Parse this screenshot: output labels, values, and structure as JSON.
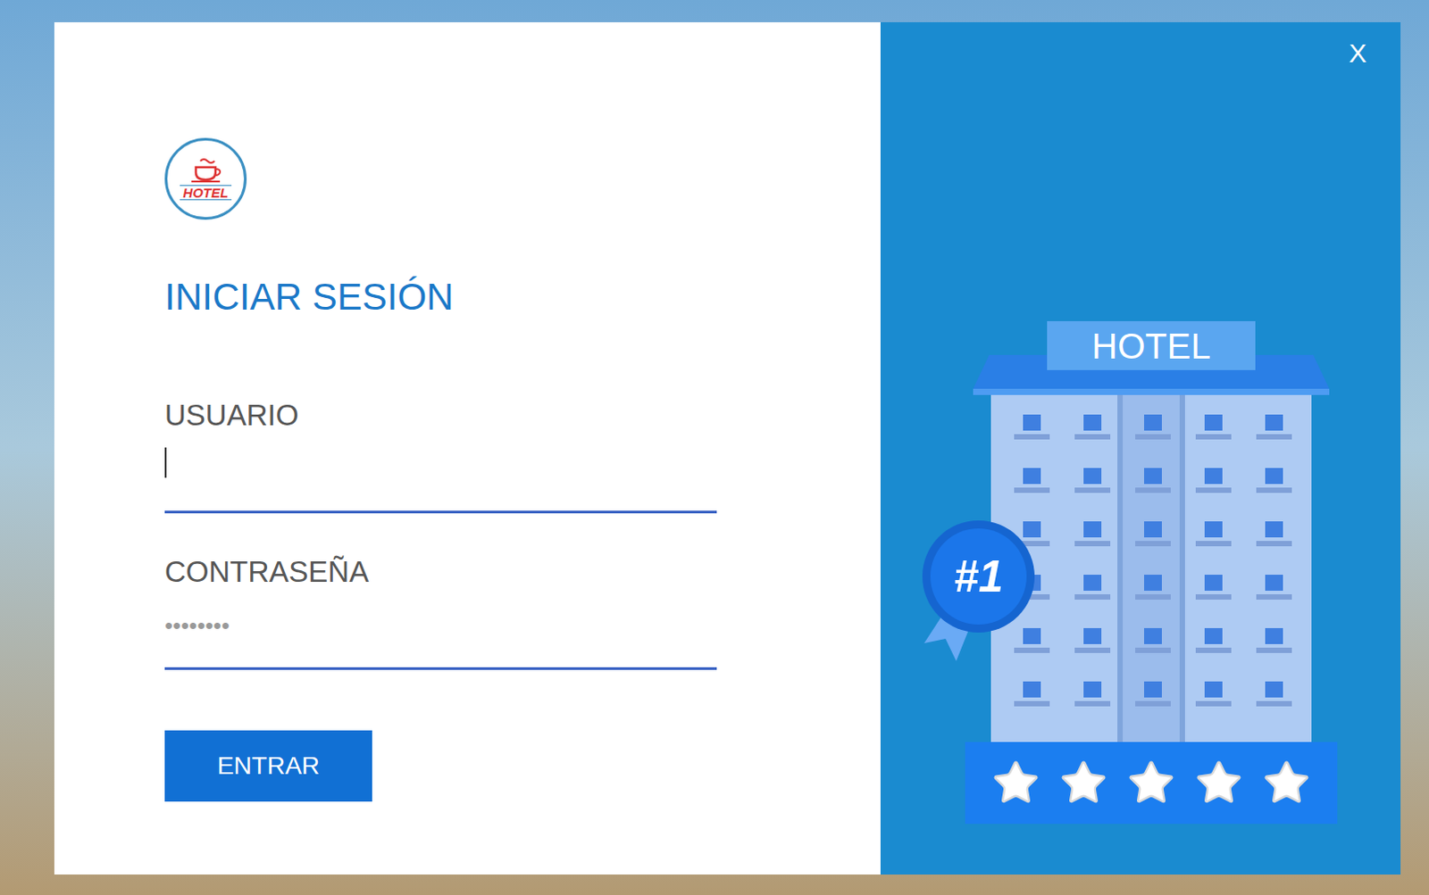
{
  "logo": {
    "text": "HOTEL"
  },
  "title": "INICIAR SESIÓN",
  "fields": [
    {
      "label": "USUARIO",
      "placeholder": "",
      "focused": true
    },
    {
      "label": "CONTRASEÑA",
      "placeholder": "••••••••",
      "focused": false
    }
  ],
  "button": "ENTRAR",
  "close": "X",
  "illustration": {
    "sign": "HOTEL",
    "badge": "#1",
    "stars": 5
  }
}
